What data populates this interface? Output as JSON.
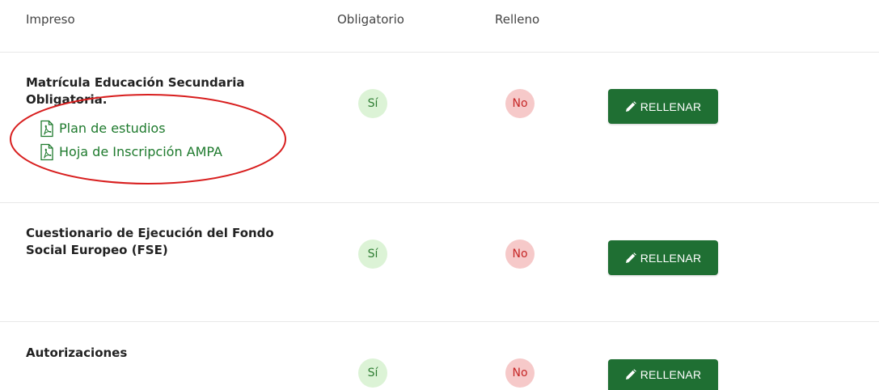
{
  "header": {
    "col_form": "Impreso",
    "col_required": "Obligatorio",
    "col_filled": "Relleno"
  },
  "rows": [
    {
      "title": "Matrícula Educación Secundaria Obligatoria.",
      "required": "Sí",
      "filled": "No",
      "action": "RELLENAR",
      "documents": [
        "Plan de estudios",
        "Hoja de Inscripción AMPA"
      ]
    },
    {
      "title": "Cuestionario de Ejecución del Fondo Social Europeo (FSE)",
      "required": "Sí",
      "filled": "No",
      "action": "RELLENAR"
    },
    {
      "title": "Autorizaciones",
      "required": "Sí",
      "filled": "No",
      "action": "RELLENAR"
    }
  ],
  "icons": {
    "document": "pdf-file-icon",
    "button": "pencil-icon"
  },
  "colors": {
    "button_bg": "#1f6f33",
    "link": "#1e7a2d",
    "yes_badge_bg": "#dcf3d6",
    "no_badge_bg": "#f6c9c9",
    "annotation": "#d81e1e"
  }
}
